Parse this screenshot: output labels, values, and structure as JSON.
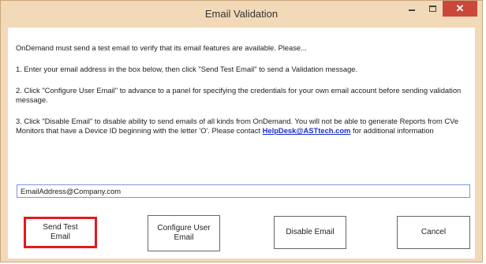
{
  "window": {
    "title": "Email Validation",
    "controls": {
      "minimize_icon": "minimize-icon",
      "maximize_icon": "maximize-icon",
      "close_icon": "close-icon",
      "close_glyph": "✕"
    }
  },
  "content": {
    "intro": "OnDemand must send a test email to verify that its email features are available. Please...",
    "step1": "1. Enter your email address in the box below, then click \"Send Test Email\" to send a Validation message.",
    "step2": "2. Click \"Configure User Email\" to advance to a panel for specifying the credentials for your own email account before sending validation message.",
    "step3_before": "3. Click \"Disable Email\" to disable ability to send emails of all kinds from OnDemand. You will not be able to generate Reports from CVe Monitors that have a Device ID beginning with the letter 'O'. Please contact ",
    "step3_link": "HelpDesk@ASTtech.com",
    "step3_after": " for additional information"
  },
  "email_input": {
    "value": "EmailAddress@Company.com"
  },
  "buttons": {
    "send_test_email": "Send Test\nEmail",
    "configure_user_email": "Configure User\nEmail",
    "disable_email": "Disable Email",
    "cancel": "Cancel"
  },
  "colors": {
    "window_frame": "#f2d9b8",
    "close_button": "#c9483a",
    "link": "#1a2fd0",
    "highlight_border": "#e11b1b"
  }
}
